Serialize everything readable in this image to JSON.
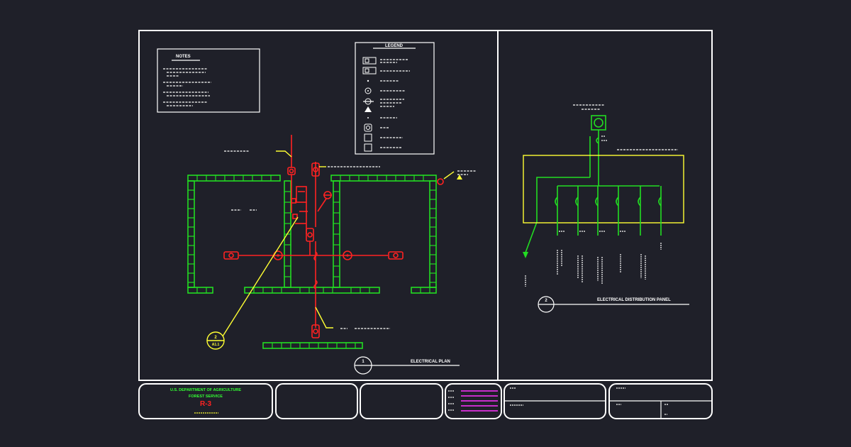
{
  "plan": {
    "notes_title": "NOTES",
    "legend_title": "LEGEND",
    "title": "ELECTRICAL PLAN",
    "number": "1",
    "callout_top": "2",
    "callout_bottom": "A1.1"
  },
  "panel": {
    "title": "ELECTRICAL DISTRIBUTION PANEL",
    "number": "2"
  },
  "title_block": {
    "agency": "U.S. DEPARTMENT OF AGRICULTURE",
    "service": "FOREST SERVICE",
    "region": "R-3"
  },
  "colors": {
    "background": "#1f2029",
    "frame": "#ffffff",
    "wall": "#22dd22",
    "circuit": "#ff2222",
    "leader": "#ffff33",
    "revision": "#ff33ff"
  }
}
